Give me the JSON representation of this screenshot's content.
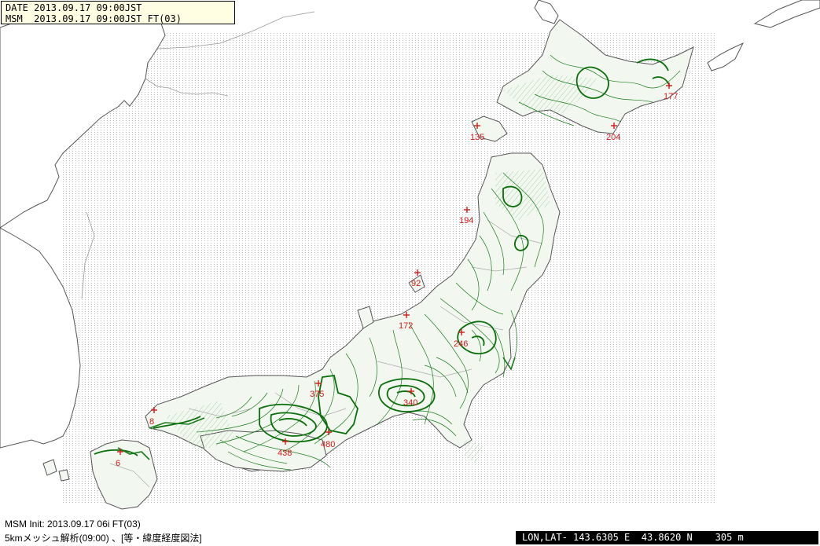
{
  "header": {
    "date_line": "DATE 2013.09.17 09:00JST",
    "model_line": "MSM  2013.09.17 09:00JST FT(03)"
  },
  "footer": {
    "init_line": "MSM Init: 2013.09.17 06i FT(03)",
    "method_line": "5kmメッシュ解析(09:00) 、[等・緯度経度図法]"
  },
  "cursor_readout": "LON,LAT- 143.6305 E  43.8620 N    305 m",
  "colors": {
    "contour": "#1a7a1a",
    "contour_thick": "#0a6e0a",
    "land_fill": "#f2f7f0",
    "coastline": "#555555",
    "grid_dots": "#b8b8b8",
    "station": "#d21a1a"
  },
  "stations": [
    {
      "label": "177"
    },
    {
      "label": "135"
    },
    {
      "label": "204"
    },
    {
      "label": "194"
    },
    {
      "label": "92"
    },
    {
      "label": "172"
    },
    {
      "label": "246"
    },
    {
      "label": "375"
    },
    {
      "label": "340"
    },
    {
      "label": "480"
    },
    {
      "label": "438"
    },
    {
      "label": "8"
    },
    {
      "label": "6"
    }
  ]
}
